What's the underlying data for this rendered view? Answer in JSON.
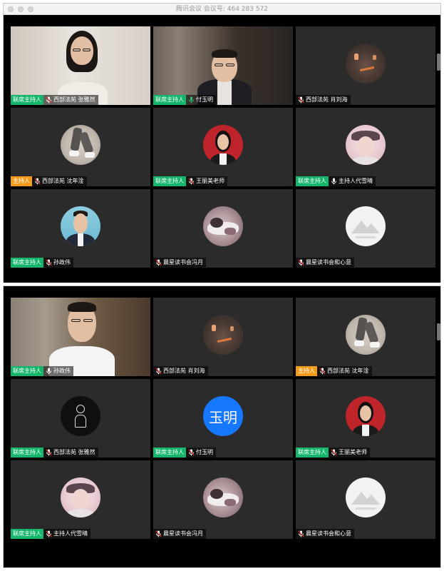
{
  "window": {
    "title": "腾讯会议  会议号: 464 283 572"
  },
  "colors": {
    "cohost_tag": "#15b66b",
    "host_tag": "#f39b1b",
    "tile_bg": "#2b2b2b",
    "avatar_blue": "#1677ff"
  },
  "grid1": {
    "tiles": [
      {
        "tag": "联席主持人",
        "name": "西部法苑 张雅然",
        "mic": "muted",
        "media": "video-young-woman"
      },
      {
        "tag": "联席主持人",
        "name": "付玉明",
        "mic": "speaking",
        "media": "video-man-glasses"
      },
      {
        "tag": "",
        "name": "西部法苑 肖刘海",
        "mic": "muted",
        "media": "avatar-lamp"
      },
      {
        "tag": "主持人",
        "name": "西部法苑 沈年淦",
        "mic": "muted",
        "media": "avatar-legs"
      },
      {
        "tag": "联席主持人",
        "name": "王丽美老师",
        "mic": "muted",
        "media": "avatar-woman-red"
      },
      {
        "tag": "联席主持人",
        "name": "主持人代雪晴",
        "mic": "unmuted",
        "media": "avatar-girl-hat"
      },
      {
        "tag": "联席主持人",
        "name": "孙政伟",
        "mic": "muted",
        "media": "avatar-man-suit"
      },
      {
        "tag": "",
        "name": "晨星读书会冯月",
        "mic": "muted",
        "media": "avatar-sleeping"
      },
      {
        "tag": "",
        "name": "晨星读书会和心意",
        "mic": "muted",
        "media": "avatar-mountain"
      }
    ]
  },
  "grid2": {
    "tiles": [
      {
        "tag": "联席主持人",
        "name": "孙政伟",
        "mic": "unmuted",
        "media": "video-man-bookshelf"
      },
      {
        "tag": "",
        "name": "西部法苑 肖刘海",
        "mic": "muted",
        "media": "avatar-lamp"
      },
      {
        "tag": "主持人",
        "name": "西部法苑 沈年淦",
        "mic": "muted",
        "media": "avatar-legs"
      },
      {
        "tag": "联席主持人",
        "name": "西部法苑 张雅然",
        "mic": "muted",
        "media": "avatar-dark-sketch"
      },
      {
        "tag": "联席主持人",
        "name": "付玉明",
        "mic": "muted",
        "media": "avatar-text",
        "avatar_text": "玉明"
      },
      {
        "tag": "联席主持人",
        "name": "王丽美老师",
        "mic": "muted",
        "media": "avatar-woman-red"
      },
      {
        "tag": "联席主持人",
        "name": "主持人代雪晴",
        "mic": "muted",
        "media": "avatar-girl-hat"
      },
      {
        "tag": "",
        "name": "晨星读书会冯月",
        "mic": "muted",
        "media": "avatar-sleeping"
      },
      {
        "tag": "",
        "name": "晨星读书会和心意",
        "mic": "muted",
        "media": "avatar-mountain"
      }
    ]
  }
}
